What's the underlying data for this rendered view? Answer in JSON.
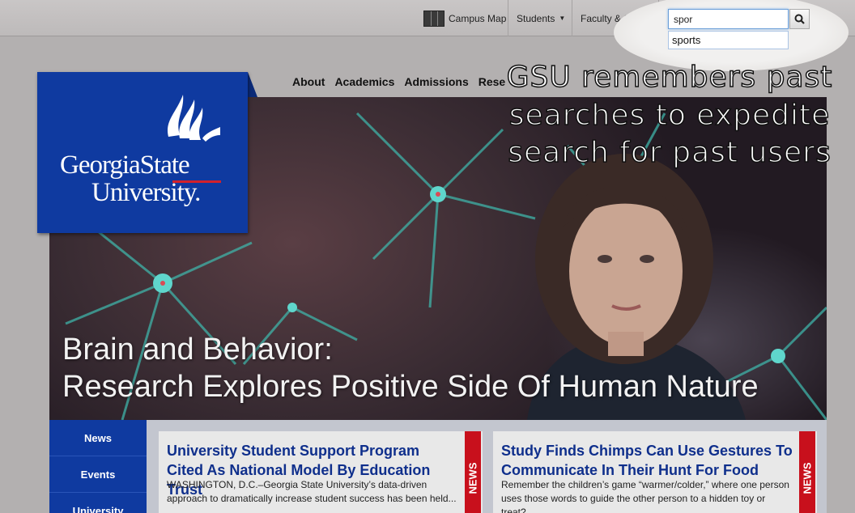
{
  "utility_nav": {
    "campus_map": "Campus Map",
    "students": "Students",
    "faculty_staff": "Faculty & Staff"
  },
  "search": {
    "value": "spor",
    "suggestion": "sports"
  },
  "logo": {
    "line1": "GeorgiaState",
    "line2": "University."
  },
  "main_nav": [
    "About",
    "Academics",
    "Admissions",
    "Rese"
  ],
  "hero": {
    "headline_line1": "Brain and Behavior:",
    "headline_line2": "Research Explores Positive Side Of Human Nature"
  },
  "annotation": {
    "line1": "GSU remembers past",
    "line2": "searches to expedite",
    "line3": "search for past users"
  },
  "side_nav": [
    "News",
    "Events",
    "University"
  ],
  "cards": [
    {
      "title": "University Student Support Program Cited As National Model By Education Trust",
      "body": "WASHINGTON, D.C.–Georgia State University’s data-driven approach to dramatically increase student success has been held...",
      "tag": "NEWS"
    },
    {
      "title": "Study Finds Chimps Can Use Gestures To Communicate In Their Hunt For Food",
      "body": "Remember the children’s game “warmer/colder,” where one person uses those words to guide the other person to a hidden toy or treat?...",
      "tag": "NEWS"
    }
  ],
  "colors": {
    "brand_blue": "#0f3aa0",
    "news_red": "#c8101c",
    "link_blue": "#0f2f8c"
  }
}
